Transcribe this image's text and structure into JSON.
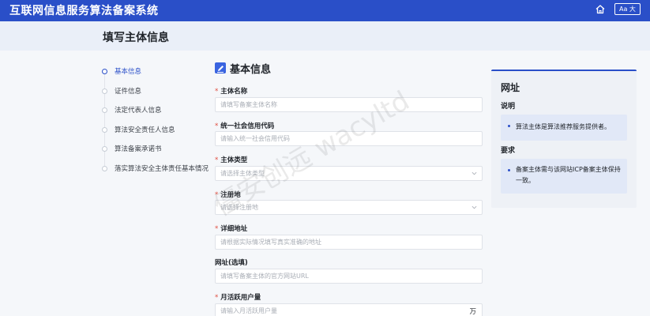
{
  "header": {
    "app_title": "互联网信息服务算法备案系统",
    "font_toggle": "Aa 大",
    "home_icon": "home-icon"
  },
  "page": {
    "title": "填写主体信息"
  },
  "steps": [
    {
      "label": "基本信息",
      "active": true
    },
    {
      "label": "证件信息",
      "active": false
    },
    {
      "label": "法定代表人信息",
      "active": false
    },
    {
      "label": "算法安全责任人信息",
      "active": false
    },
    {
      "label": "算法备案承诺书",
      "active": false
    },
    {
      "label": "落实算法安全主体责任基本情况",
      "active": false
    }
  ],
  "form": {
    "section_title": "基本信息",
    "section_icon": "edit-icon",
    "fields": [
      {
        "label": "主体名称",
        "required": true,
        "placeholder": "请填写备案主体名称",
        "type": "text"
      },
      {
        "label": "统一社会信用代码",
        "required": true,
        "placeholder": "请输入统一社会信用代码",
        "type": "text"
      },
      {
        "label": "主体类型",
        "required": true,
        "placeholder": "请选择主体类型",
        "type": "select"
      },
      {
        "label": "注册地",
        "required": true,
        "placeholder": "请选择注册地",
        "type": "select"
      },
      {
        "label": "详细地址",
        "required": true,
        "placeholder": "请根据实际情况填写真实准确的地址",
        "type": "text"
      },
      {
        "label": "网址(选填)",
        "required": false,
        "placeholder": "请填写备案主体的官方网站URL",
        "type": "text"
      },
      {
        "label": "月活跃用户量",
        "required": true,
        "placeholder": "请输入月活跃用户量",
        "type": "text",
        "suffix": "万"
      }
    ]
  },
  "sidebar": {
    "title": "网址",
    "description_heading": "说明",
    "description_text": "算法主体是算法推荐服务提供者。",
    "requirement_heading": "要求",
    "requirement_text": "备案主体需与该网站ICP备案主体保持一致。"
  },
  "watermark": "僵安创远 wacyltd",
  "colors": {
    "primary": "#2a4fc8",
    "required": "#e04c3e",
    "subheader_bg": "#eaeff8",
    "panel_bg": "#eef1f6"
  }
}
